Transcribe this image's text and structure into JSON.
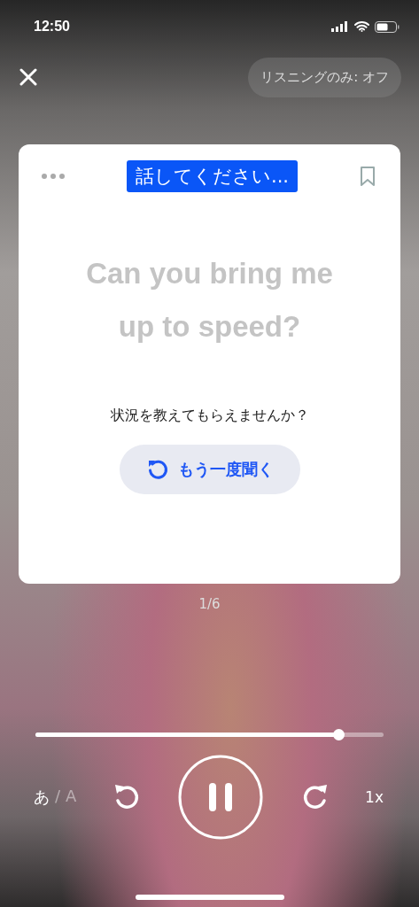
{
  "status_bar": {
    "time": "12:50"
  },
  "top_bar": {
    "listening_only": "リスニングのみ: オフ"
  },
  "card": {
    "prompt": "話してください...",
    "english": "Can you bring me up to speed?",
    "translation": "状況を教えてもらえませんか？",
    "replay": "もう一度聞く"
  },
  "counter": "1/6",
  "player": {
    "level": 0.87,
    "language": [
      {
        "label": "あ",
        "selected": true
      },
      {
        "label": "A",
        "selected": false
      }
    ],
    "separator": "/",
    "speed": "1x"
  }
}
